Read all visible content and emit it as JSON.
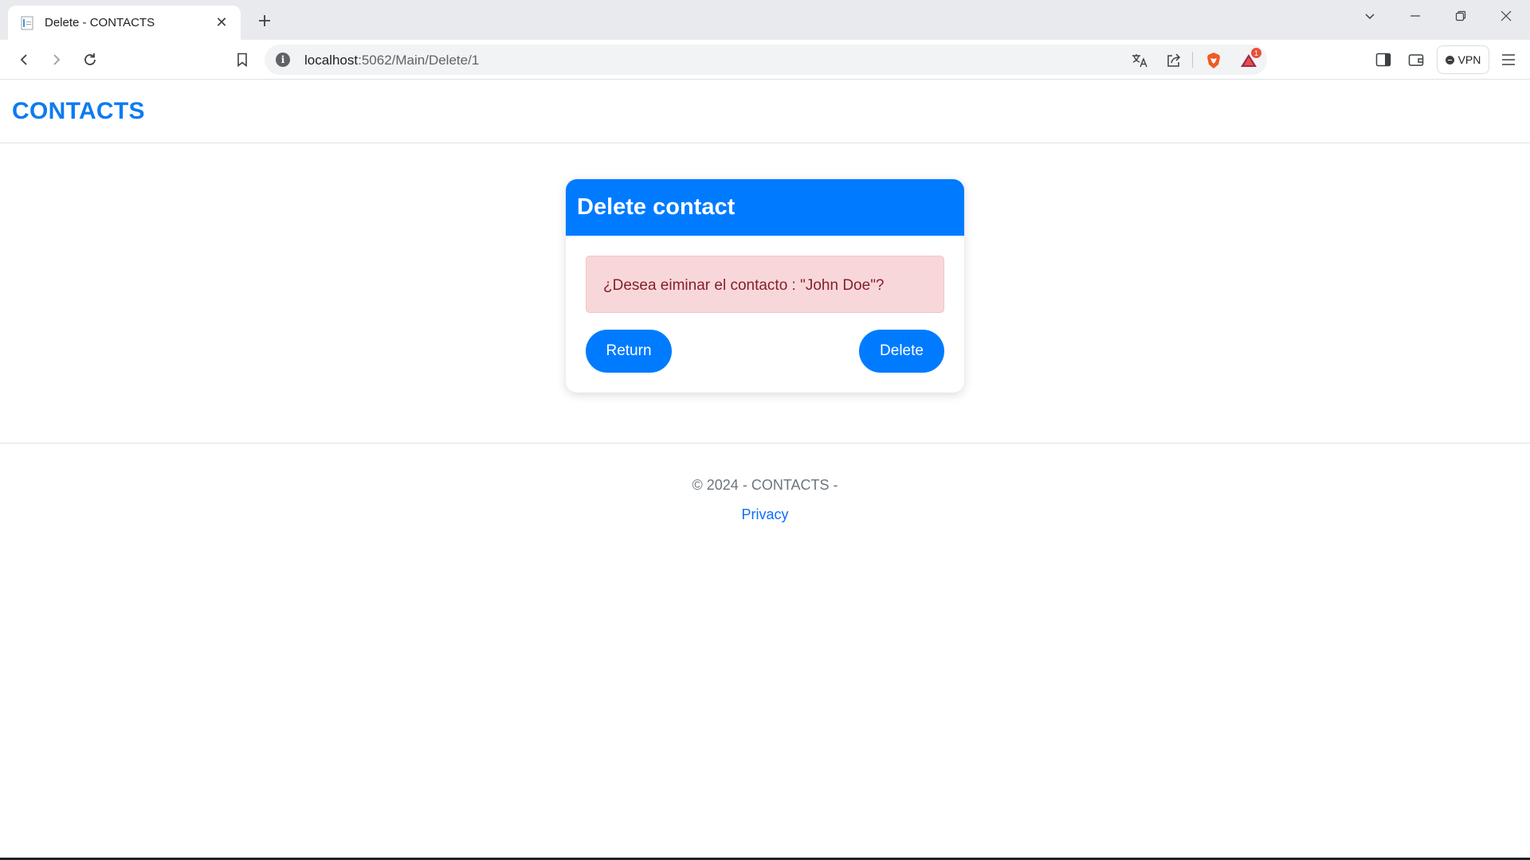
{
  "browser": {
    "tab_title": "Delete - CONTACTS",
    "url_host": "localhost",
    "url_path": ":5062/Main/Delete/1",
    "extension_badge": "1",
    "vpn_label": "VPN"
  },
  "page": {
    "brand": "CONTACTS",
    "card": {
      "title": "Delete contact",
      "message": "¿Desea eiminar el contacto : \"John Doe\"?",
      "return_label": "Return",
      "delete_label": "Delete"
    },
    "footer": {
      "copyright": "© 2024 - CONTACTS -",
      "privacy_label": "Privacy"
    }
  },
  "colors": {
    "primary": "#007bff",
    "brand": "#0d7bf0",
    "alert_bg": "#f8d7da",
    "alert_text": "#842029",
    "link": "#0d6efd"
  },
  "icons": [
    "page-favicon-icon",
    "close-icon",
    "plus-icon",
    "chevron-down-icon",
    "minimize-icon",
    "restore-icon",
    "window-close-icon",
    "back-icon",
    "forward-icon",
    "reload-icon",
    "bookmark-icon",
    "info-icon",
    "translate-icon",
    "share-icon",
    "brave-shield-icon",
    "brave-rewards-icon",
    "sidebar-icon",
    "wallet-icon",
    "vpn-icon",
    "menu-icon"
  ]
}
